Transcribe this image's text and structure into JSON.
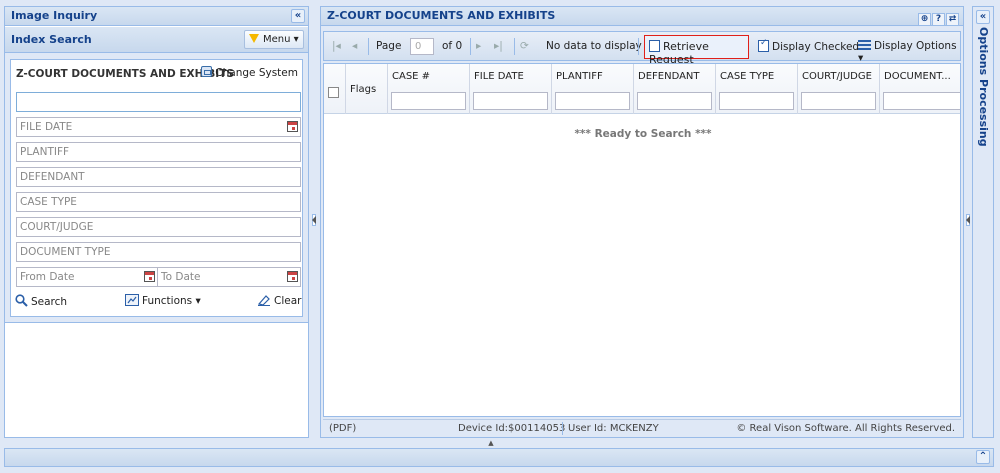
{
  "left_panel": {
    "title": "Image Inquiry",
    "collapse_glyph": "«",
    "index_search": {
      "title": "Index Search",
      "menu_label": "Menu ▾",
      "system_title": "Z-COURT DOCUMENTS AND EXHIBITS",
      "change_system_label": "Change System",
      "fields": {
        "main_value": "",
        "file_date": "FILE DATE",
        "plantiff": "PLANTIFF",
        "defendant": "DEFENDANT",
        "case_type": "CASE TYPE",
        "court_judge": "COURT/JUDGE",
        "document_type": "DOCUMENT TYPE",
        "from_date": "From Date",
        "to_date": "To Date"
      },
      "buttons": {
        "search": "Search",
        "functions": "Functions ▾",
        "clear": "Clear"
      }
    }
  },
  "main_panel": {
    "title": "Z-COURT DOCUMENTS AND EXHIBITS",
    "header_tools": [
      "⊕",
      "?",
      "⇄"
    ],
    "toolbar": {
      "page_label": "Page",
      "page_value": "0",
      "of_label": "of 0",
      "no_data": "No data to display",
      "retrieve_request": "Retrieve Request",
      "display_checked": "Display Checked",
      "display_options": "Display Options ▾"
    },
    "grid": {
      "columns": [
        "Flags",
        "CASE #",
        "FILE DATE",
        "PLANTIFF",
        "DEFENDANT",
        "CASE TYPE",
        "COURT/JUDGE",
        "DOCUMENT..."
      ],
      "empty_message": "*** Ready to Search ***"
    },
    "status_bar": {
      "format": "(PDF)",
      "device": "Device Id:$00114053",
      "user": "User Id: MCKENZY",
      "copyright": "© Real Vison Software. All Rights Reserved."
    }
  },
  "right_panel": {
    "title": "Options Processing",
    "collapse_glyph": "«"
  },
  "bottom_panel": {
    "expand_glyph": "⌃"
  },
  "colors": {
    "header_text": "#15428b",
    "border": "#99bbe8",
    "highlight": "#e0201a"
  }
}
